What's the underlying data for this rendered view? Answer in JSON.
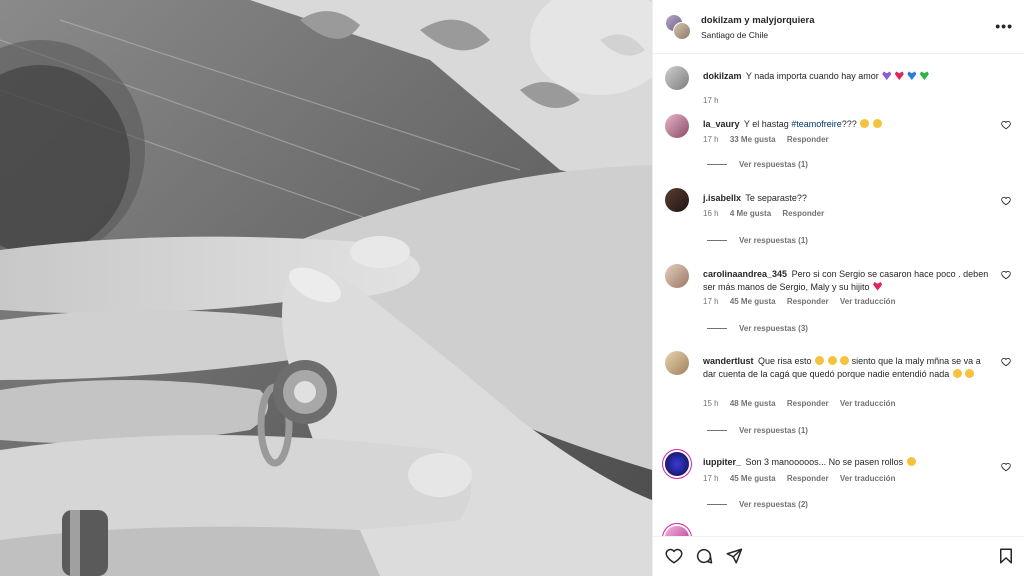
{
  "header": {
    "users": "dokilzam y malyjorquiera",
    "location": "Santiago de Chile",
    "options_icon": "more-horizontal-icon"
  },
  "caption": {
    "user": "dokilzam",
    "text": "Y nada importa cuando hay amor",
    "emojis": [
      "purple-heart",
      "red-heart",
      "blue-heart",
      "green-heart"
    ],
    "time": "17 h"
  },
  "comments": [
    {
      "user": "la_vaury",
      "text": "Y el hastag",
      "tag": "#teamofreire",
      "text_after": "???",
      "emojis": [
        "sad-face",
        "sad-face"
      ],
      "time": "17 h",
      "likes": "33 Me gusta",
      "reply": "Responder",
      "translate": "",
      "replies": "Ver respuestas (1)"
    },
    {
      "user": "j.isabellx",
      "text": "Te separaste??",
      "time": "16 h",
      "likes": "4 Me gusta",
      "reply": "Responder",
      "translate": "",
      "replies": "Ver respuestas (1)"
    },
    {
      "user": "carolinaandrea_345",
      "text": "Pero si con Sergio se casaron hace poco . deben ser más manos de Sergio, Maly y su hijito",
      "emojis": [
        "red-heart"
      ],
      "time": "17 h",
      "likes": "45 Me gusta",
      "reply": "Responder",
      "translate": "Ver traducción",
      "replies": "Ver respuestas (3)"
    },
    {
      "user": "wandertlust",
      "text_a": "Que risa esto",
      "text_b": "siento que la maly mñna se va a dar cuenta de la cagá que quedó porque nadie entendió nada",
      "time": "15 h",
      "likes": "48 Me gusta",
      "reply": "Responder",
      "translate": "Ver traducción",
      "replies": "Ver respuestas (1)"
    },
    {
      "user": "iuppiter_",
      "text": "Son 3 manooooos... No se pasen rollos",
      "time": "17 h",
      "likes": "45 Me gusta",
      "reply": "Responder",
      "translate": "Ver traducción",
      "replies": "Ver respuestas (2)"
    }
  ],
  "actions": {
    "like_icon": "heart-icon",
    "comment_icon": "comment-icon",
    "share_icon": "send-icon",
    "save_icon": "bookmark-icon"
  }
}
